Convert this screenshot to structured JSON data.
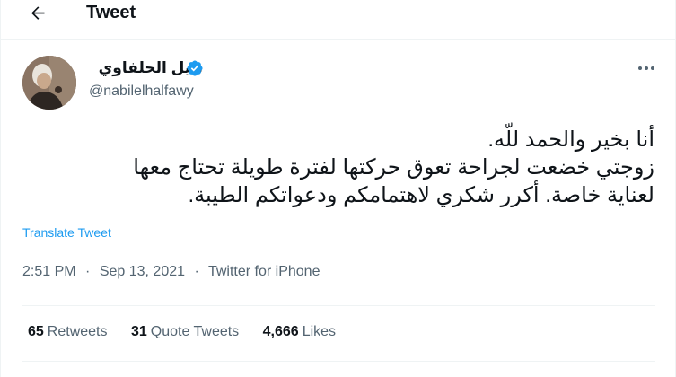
{
  "header": {
    "title": "Tweet",
    "back_icon": "arrow-left-icon"
  },
  "author": {
    "display_name": "نبيل الحلفاوي",
    "handle": "@nabilelhalfawy",
    "verified_icon": "verified-badge-icon",
    "verified_color": "#1d9bf0"
  },
  "tweet": {
    "lines": [
      "أنا بخير والحمد للّه.",
      "زوجتي خضعت لجراحة تعوق حركتها لفترة طويلة تحتاج معها",
      "لعناية خاصة. أكرر شكري لاهتمامكم ودعواتكم الطيبة."
    ],
    "translate_label": "Translate Tweet",
    "translate_color": "#1d9bf0"
  },
  "meta": {
    "time": "2:51 PM",
    "separator": "·",
    "date": "Sep 13, 2021",
    "source": "Twitter for iPhone"
  },
  "stats": {
    "retweets_count": "65",
    "retweets_label": "Retweets",
    "quotes_count": "31",
    "quotes_label": "Quote Tweets",
    "likes_count": "4,666",
    "likes_label": "Likes"
  },
  "icons": {
    "more": "more-horizontal-icon"
  }
}
